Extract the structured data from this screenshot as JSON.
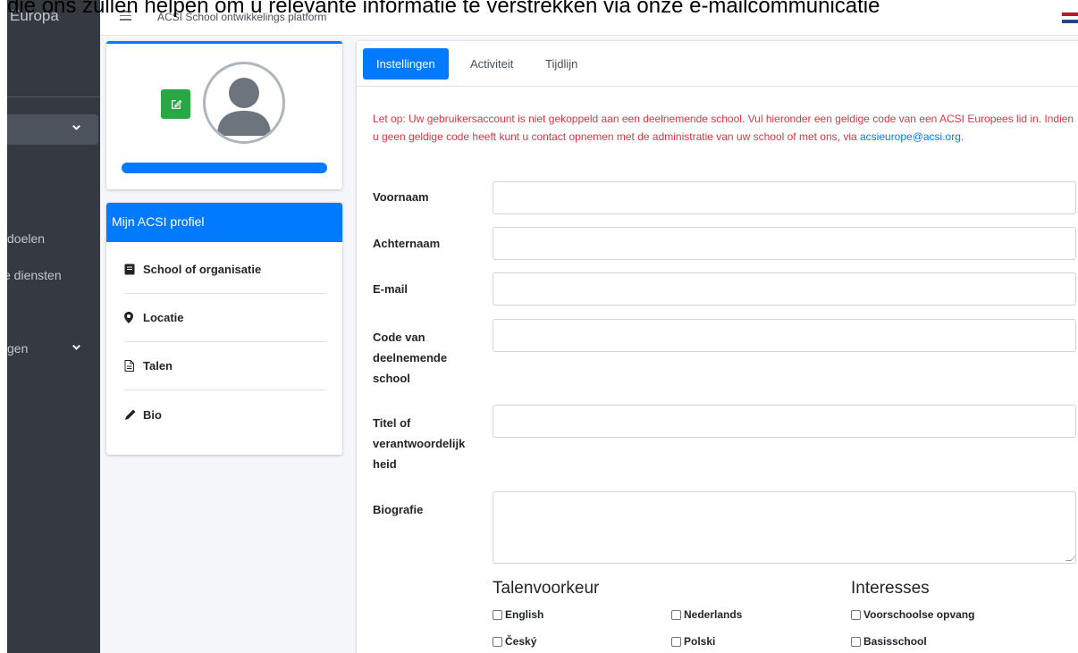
{
  "overlay": {
    "text": "die ons zullen helpen om u relevante informatie te verstrekken via onze e-mailcommunicatie"
  },
  "sidebar": {
    "brand": "Europa",
    "items": [
      {
        "label": "doelen"
      },
      {
        "label": "e diensten"
      },
      {
        "label": "gen"
      }
    ]
  },
  "navbar": {
    "title": "ACSI School ontwikkelings platform",
    "flag_colors": [
      "#ae1c28",
      "#ffffff",
      "#21468b"
    ]
  },
  "profile_menu": {
    "header": "Mijn ACSI profiel",
    "items": [
      {
        "label": "School of organisatie",
        "icon": "book-icon"
      },
      {
        "label": "Locatie",
        "icon": "map-marker-icon"
      },
      {
        "label": "Talen",
        "icon": "file-icon"
      },
      {
        "label": "Bio",
        "icon": "pencil-icon"
      }
    ]
  },
  "tabs": [
    {
      "label": "Instellingen",
      "active": true
    },
    {
      "label": "Activiteit",
      "active": false
    },
    {
      "label": "Tijdlijn",
      "active": false
    }
  ],
  "notice": {
    "text": "Let op: Uw gebruikersaccount is niet gekoppeld aan een deelnemende school. Vul hieronder een geldige code van een ACSI Europees lid in. Indien u geen geldige code heeft kunt u contact opnemen met de administratie van uw school of met ons, via ",
    "email": "acsieurope@acsi.org",
    "suffix": "."
  },
  "form": {
    "voornaam": {
      "label": "Voornaam",
      "value": ""
    },
    "achternaam": {
      "label": "Achternaam",
      "value": ""
    },
    "email": {
      "label": "E-mail",
      "value": ""
    },
    "code": {
      "label": "Code van deelnemende school",
      "value": ""
    },
    "titel": {
      "label": "Titel of verantwoordelijk heid",
      "value": ""
    },
    "biografie": {
      "label": "Biografie",
      "value": ""
    }
  },
  "talen": {
    "title": "Talenvoorkeur",
    "options": [
      "English",
      "Nederlands",
      "Český",
      "Polski"
    ]
  },
  "interesses": {
    "title": "Interesses",
    "options": [
      "Voorschoolse opvang",
      "Basisschool"
    ]
  },
  "colors": {
    "primary": "#007bff",
    "sidebar": "#343a40",
    "success": "#28a745",
    "danger": "#dc3545"
  }
}
